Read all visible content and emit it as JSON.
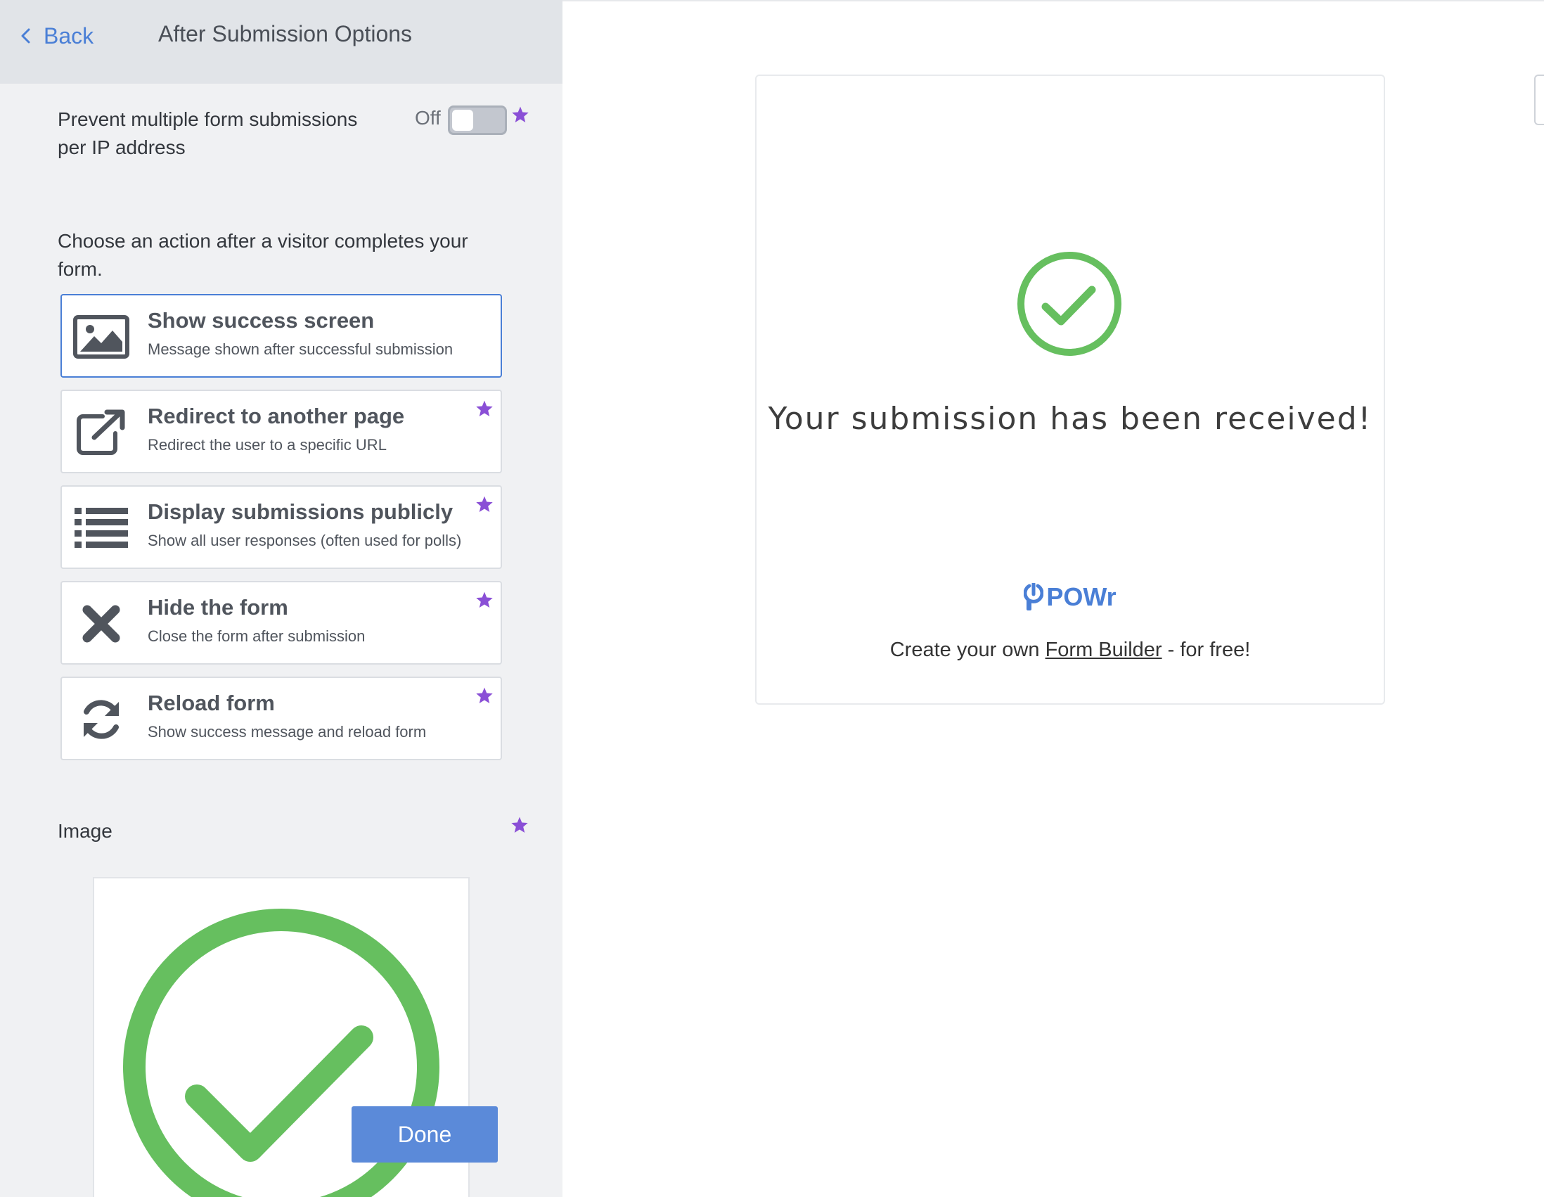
{
  "header": {
    "back_label": "Back",
    "title": "After Submission Options"
  },
  "ip_setting": {
    "label": "Prevent multiple form submissions per IP address",
    "state_label": "Off",
    "enabled": false
  },
  "choose_text": "Choose an action after a visitor completes your form.",
  "options": [
    {
      "title": "Show success screen",
      "desc": "Message shown after successful submission",
      "icon": "image-icon",
      "selected": true,
      "premium": false
    },
    {
      "title": "Redirect to another page",
      "desc": "Redirect the user to a specific URL",
      "icon": "external-link-icon",
      "selected": false,
      "premium": true
    },
    {
      "title": "Display submissions publicly",
      "desc": "Show all user responses (often used for polls)",
      "icon": "list-icon",
      "selected": false,
      "premium": true
    },
    {
      "title": "Hide the form",
      "desc": "Close the form after submission",
      "icon": "close-icon",
      "selected": false,
      "premium": true
    },
    {
      "title": "Reload form",
      "desc": "Show success message and reload form",
      "icon": "refresh-icon",
      "selected": false,
      "premium": true
    }
  ],
  "image_label": "Image",
  "done_label": "Done",
  "preview": {
    "success_message": "Your submission has been received!",
    "brand": "POWr",
    "cta_prefix": "Create your own ",
    "cta_link": "Form Builder",
    "cta_suffix": " - for free!"
  },
  "colors": {
    "accent": "#4a7fd6",
    "success_green": "#66bf5f",
    "premium_star": "#8a4fd6",
    "done_button": "#5b8ad9"
  }
}
